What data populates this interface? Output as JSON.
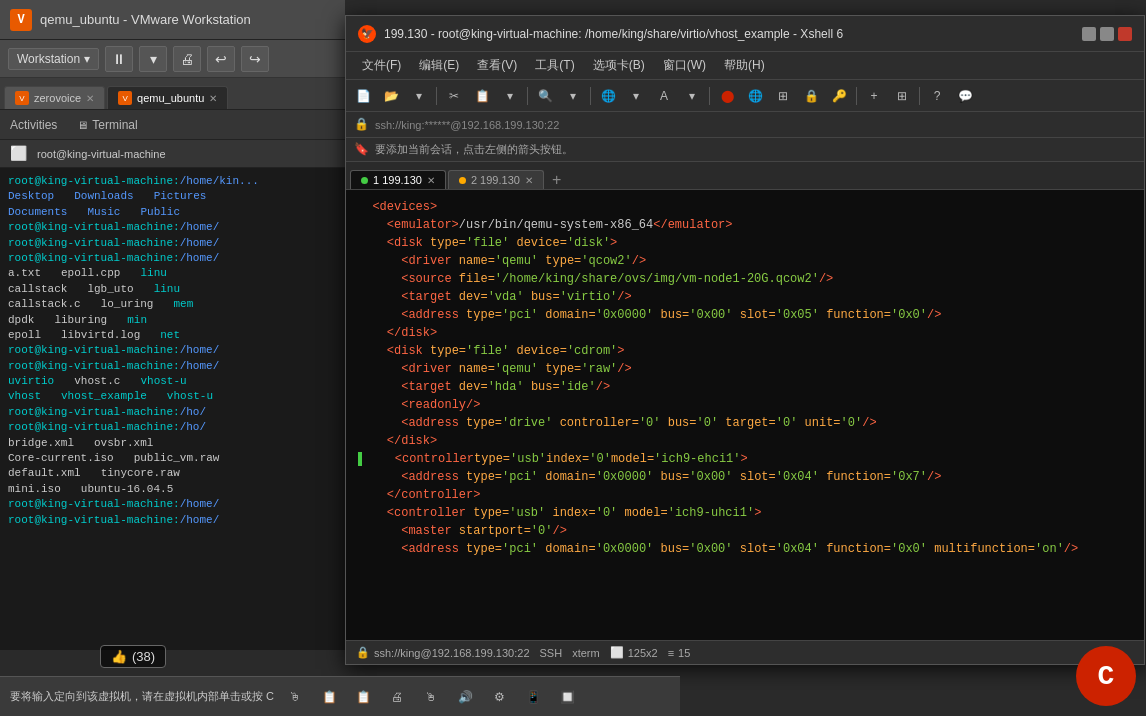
{
  "vmware": {
    "title": "qemu_ubuntu - VMware Workstation",
    "logo_text": "V",
    "toolbar": {
      "workstation_label": "Workstation",
      "dropdown_symbol": "▾"
    },
    "tabs": [
      {
        "label": "zerovoice",
        "active": false
      },
      {
        "label": "qemu_ubuntu",
        "active": true
      }
    ],
    "sub_toolbar": {
      "activities": "Activities",
      "terminal": "Terminal"
    },
    "terminal_header": {
      "path": "root@king-virtual-machine"
    },
    "terminal_lines": [
      {
        "type": "prompt",
        "text": "root@king-virtual-machine:/home/kin..."
      },
      {
        "type": "dir_row",
        "items": [
          "Desktop",
          "Downloads",
          "Pictures"
        ]
      },
      {
        "type": "dir_row2",
        "items": [
          "Documents",
          "Music",
          "Public"
        ]
      },
      {
        "type": "prompt2",
        "text": "root@king-virtual-machine:/home/"
      },
      {
        "type": "prompt2",
        "text": "root@king-virtual-machine:/home/"
      },
      {
        "type": "prompt2",
        "text": "root@king-virtual-machine:/home/"
      },
      {
        "type": "file_row",
        "items": [
          "a.txt",
          "epoll.cpp",
          "linu"
        ]
      },
      {
        "type": "file_row",
        "items": [
          "callstack",
          "lgb_uto",
          "linu"
        ]
      },
      {
        "type": "file_row",
        "items": [
          "callstack.c",
          "lo_uring",
          "mem"
        ]
      },
      {
        "type": "file_row",
        "items": [
          "dpdk",
          "liburing",
          "min"
        ]
      },
      {
        "type": "file_row",
        "items": [
          "epoll",
          "libvirtd.log",
          "net"
        ]
      },
      {
        "type": "prompt2",
        "text": "root@king-virtual-machine:/home/"
      },
      {
        "type": "prompt2",
        "text": "root@king-virtual-machine:/home/"
      },
      {
        "type": "file_row",
        "items": [
          "uvirtio",
          "vhost.c",
          "vhost-u"
        ]
      },
      {
        "type": "file_row",
        "items": [
          "vhost",
          "vhost_example",
          "vhost-u"
        ]
      },
      {
        "type": "prompt2",
        "text": "root@king-virtual-machine:/ho/"
      },
      {
        "type": "prompt2",
        "text": "root@king-virtual-machine:/ho/"
      },
      {
        "type": "file_row",
        "items": [
          "bridge.xml",
          "ovsbr.xml"
        ]
      },
      {
        "type": "file_row",
        "items": [
          "Core-current.iso",
          "public_vm.raw"
        ]
      },
      {
        "type": "file_row",
        "items": [
          "default.xml",
          "tinycore.raw"
        ]
      },
      {
        "type": "file_row",
        "items": [
          "mini.iso",
          "ubuntu-16.04.5"
        ]
      },
      {
        "type": "prompt2",
        "text": "root@king-virtual-machine:/home/"
      },
      {
        "type": "prompt2",
        "text": "root@king-virtual-machine:/home/"
      }
    ]
  },
  "xshell": {
    "title": "199.130 - root@king-virtual-machine: /home/king/share/virtio/vhost_example - Xshell 6",
    "favicon": "🦅",
    "menu_items": [
      "文件(F)",
      "编辑(E)",
      "查看(V)",
      "工具(T)",
      "选项卡(B)",
      "窗口(W)",
      "帮助(H)"
    ],
    "address": "ssh://king:******@192.168.199.130:22",
    "hint": "要添加当前会话，点击左侧的箭头按钮。",
    "tabs": [
      {
        "label": "1 199.130",
        "active": true,
        "dot": "green"
      },
      {
        "label": "2 199.130",
        "active": false,
        "dot": "yellow"
      }
    ],
    "terminal_content": [
      "  <devices>",
      "    <emulator>/usr/bin/qemu-system-x86_64</emulator>",
      "    <disk type='file' device='disk'>",
      "      <driver name='qemu' type='qcow2'/>",
      "      <source file='/home/king/share/ovs/img/vm-node1-20G.qcow2'/>",
      "      <target dev='vda' bus='virtio'/>",
      "      <address type='pci' domain='0x0000' bus='0x00' slot='0x05' function='0x0'/>",
      "    </disk>",
      "    <disk type='file' device='cdrom'>",
      "      <driver name='qemu' type='raw'/>",
      "      <target dev='hda' bus='ide'/>",
      "      <readonly/>",
      "      <address type='drive' controller='0' bus='0' target='0' unit='0'/>",
      "    </disk>",
      "    <controller type='usb' index='0' model='ich9-ehci1'>",
      "      <address type='pci' domain='0x0000' bus='0x00' slot='0x04' function='0x7'/>",
      "    </controller>",
      "    <controller type='usb' index='0' model='ich9-uhci1'>",
      "      <master startport='0'/>",
      "      <address type='pci' domain='0x0000' bus='0x00' slot='0x04' function='0x0' multifunction='on'/>"
    ],
    "statusbar": {
      "ssh_label": "SSH",
      "xterm_label": "xterm",
      "address": "ssh://king@192.168.199.130:22",
      "dimensions": "125x2",
      "line": "15"
    }
  },
  "statusbar": {
    "text": "要将输入定向到该虚拟机，请在虚拟机内部单击或按 C",
    "icons": [
      "🖰",
      "📋",
      "📋",
      "🖨",
      "🖱",
      "🔊",
      "⚙",
      "📱",
      "🔲"
    ]
  },
  "like_badge": {
    "icon": "👍",
    "count": "(38)"
  }
}
